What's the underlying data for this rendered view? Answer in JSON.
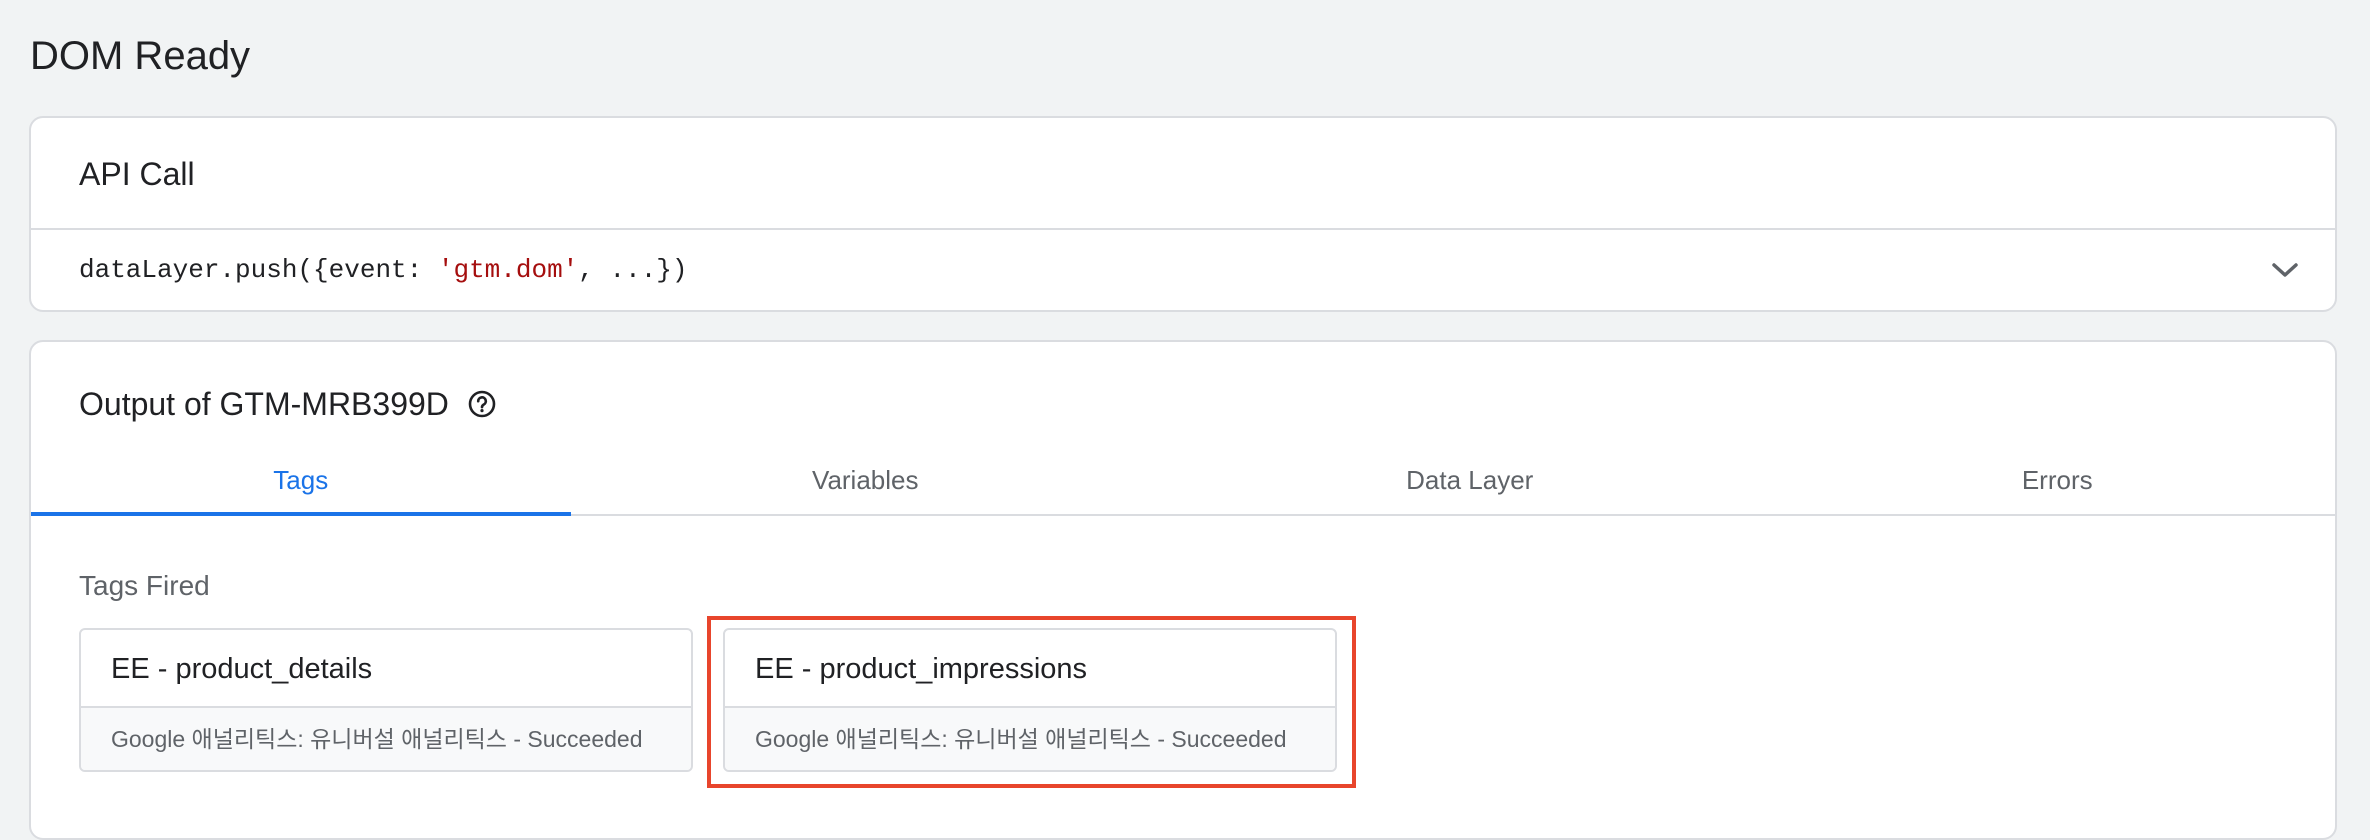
{
  "page": {
    "title": "DOM Ready"
  },
  "api_card": {
    "title": "API Call",
    "code_prefix": "dataLayer.push({event: ",
    "code_string": "'gtm.dom'",
    "code_suffix": ", ...})",
    "expand_icon": "chevron-down-icon"
  },
  "output": {
    "title": "Output of GTM-MRB399D",
    "help_icon": "help-circle-icon",
    "tabs": [
      {
        "label": "Tags",
        "active": true
      },
      {
        "label": "Variables",
        "active": false
      },
      {
        "label": "Data Layer",
        "active": false
      },
      {
        "label": "Errors",
        "active": false
      }
    ],
    "tags_fired_label": "Tags Fired",
    "tags": [
      {
        "name": "EE - product_details",
        "status": "Google 애널리틱스: 유니버설 애널리틱스 - Succeeded",
        "highlighted": false
      },
      {
        "name": "EE - product_impressions",
        "status": "Google 애널리틱스: 유니버설 애널리틱스 - Succeeded",
        "highlighted": true
      }
    ]
  },
  "colors": {
    "accent": "#1a73e8",
    "highlight": "#e8452c",
    "code_string": "#a50e0e",
    "background": "#f1f3f4"
  }
}
